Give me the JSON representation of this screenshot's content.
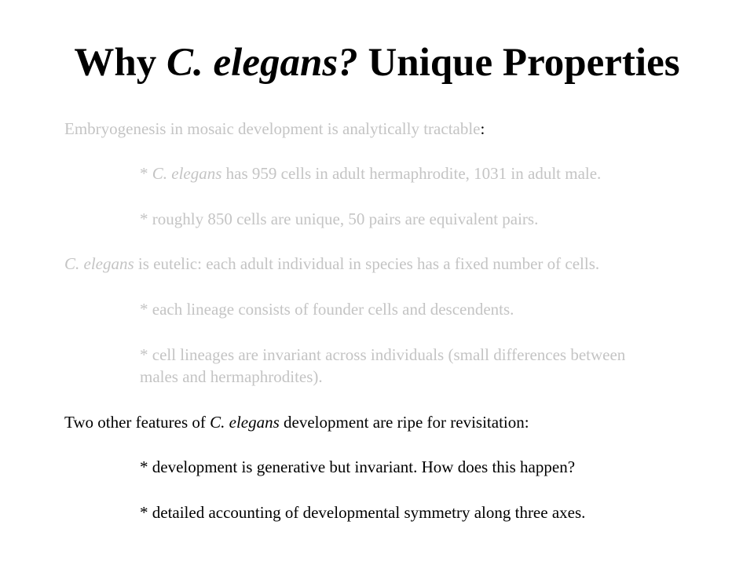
{
  "slide": {
    "title": {
      "part1": "Why ",
      "italic": "C. elegans?",
      "part2": " Unique Properties"
    },
    "faded_color": "#c4c4c4",
    "dark_color": "#000000",
    "bullets": {
      "b1": {
        "text_main": "Embryogenesis in mosaic development is analytically tractable",
        "text_tail": ":"
      },
      "b1a": {
        "prefix": "* ",
        "italic": "C. elegans",
        "rest": " has 959 cells in adult hermaphrodite, 1031 in adult male."
      },
      "b1b": {
        "text": "* roughly 850 cells are unique, 50 pairs are equivalent pairs."
      },
      "b2": {
        "italic": "C. elegans",
        "rest": " is eutelic: each adult individual in species has a fixed number of cells."
      },
      "b2a": {
        "text": "* each lineage consists of founder cells and descendents."
      },
      "b2b": {
        "line1": "* cell lineages are invariant across individuals (small differences between",
        "line2": "males and hermaphrodites)."
      },
      "b3": {
        "prefix": "Two other features of ",
        "italic": "C. elegans",
        "rest": " development are ripe for revisitation:"
      },
      "b3a": {
        "text": "* development is generative but invariant. How does this happen?"
      },
      "b3b": {
        "text": "* detailed accounting of developmental symmetry along three axes."
      }
    }
  }
}
